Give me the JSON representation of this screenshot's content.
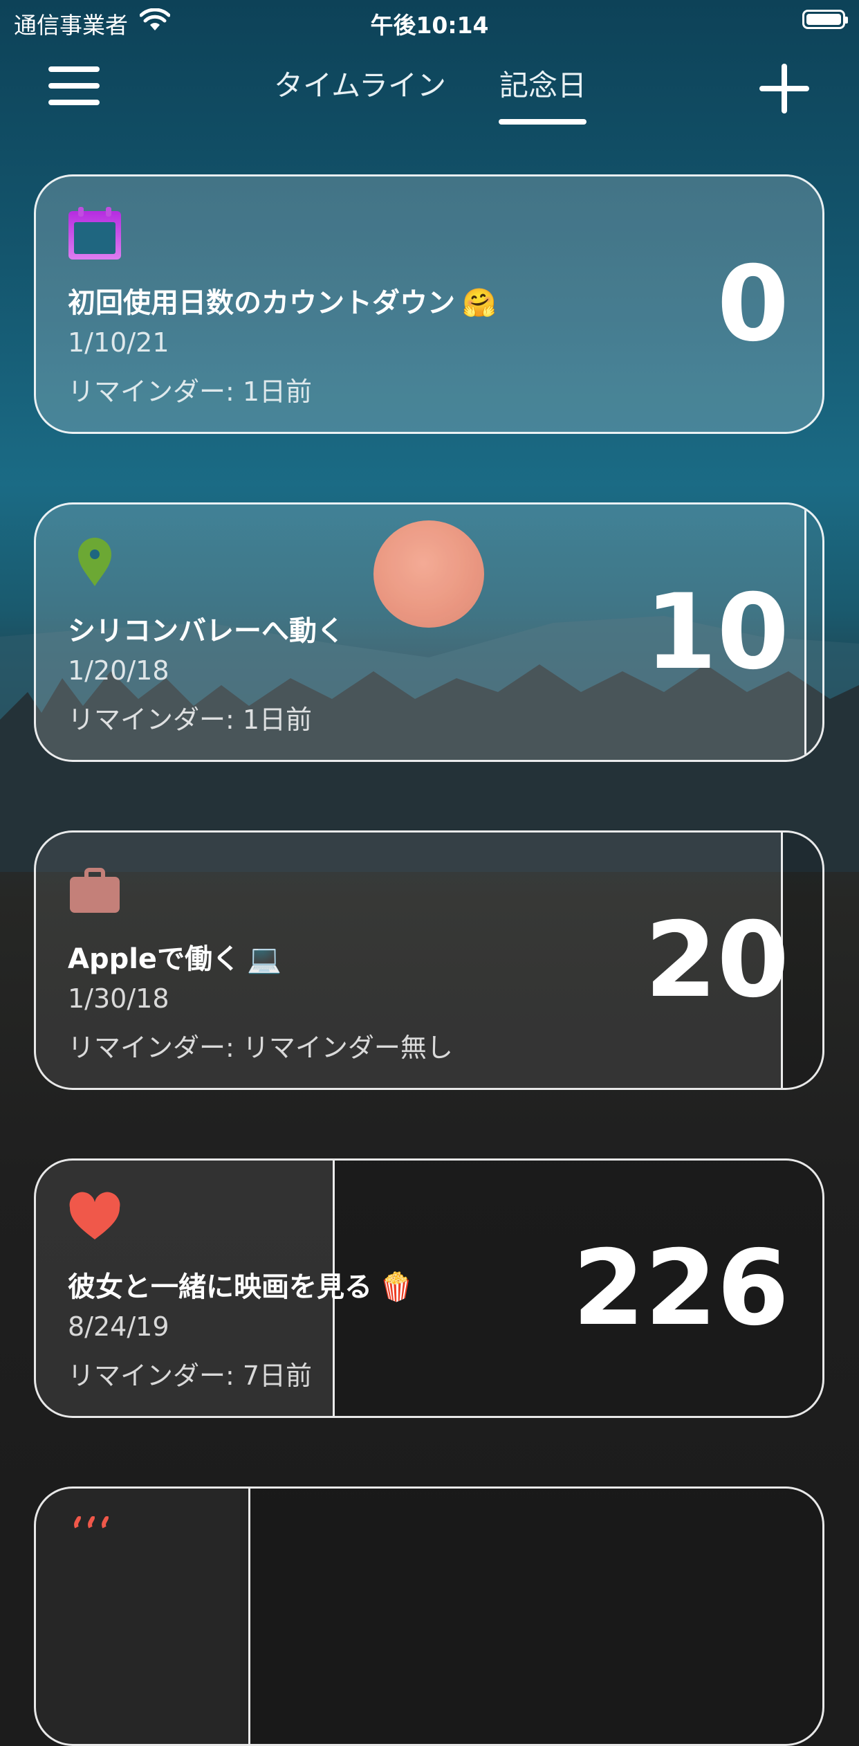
{
  "status_bar": {
    "carrier": "通信事業者",
    "time": "午後10:14"
  },
  "nav": {
    "tabs": [
      {
        "label": "タイムライン",
        "active": false
      },
      {
        "label": "記念日",
        "active": true
      }
    ]
  },
  "colors": {
    "calendar_icon": "#c04de0",
    "pin_icon": "#6ca834",
    "briefcase_icon": "#c48079",
    "heart_icon": "#f0584a",
    "progress_fill": "rgba(255,255,255,0.10)"
  },
  "cards": [
    {
      "icon": "calendar-icon",
      "title": "初回使用日数のカウントダウン",
      "title_emoji": "🤗",
      "date": "1/10/21",
      "reminder": "リマインダー: 1日前",
      "count": "0",
      "progress": 1.0
    },
    {
      "icon": "map-pin-icon",
      "title": "シリコンバレーへ動く",
      "title_emoji": "",
      "date": "1/20/18",
      "reminder": "リマインダー: 1日前",
      "count": "10",
      "progress": 0.98
    },
    {
      "icon": "briefcase-icon",
      "title": "Appleで働く",
      "title_emoji": "💻",
      "date": "1/30/18",
      "reminder": "リマインダー: リマインダー無し",
      "count": "20",
      "progress": 0.95
    },
    {
      "icon": "heart-icon",
      "title": "彼女と一緒に映画を見る",
      "title_emoji": "🍿",
      "date": "8/24/19",
      "reminder": "リマインダー: 7日前",
      "count": "226",
      "progress": 0.38
    }
  ]
}
